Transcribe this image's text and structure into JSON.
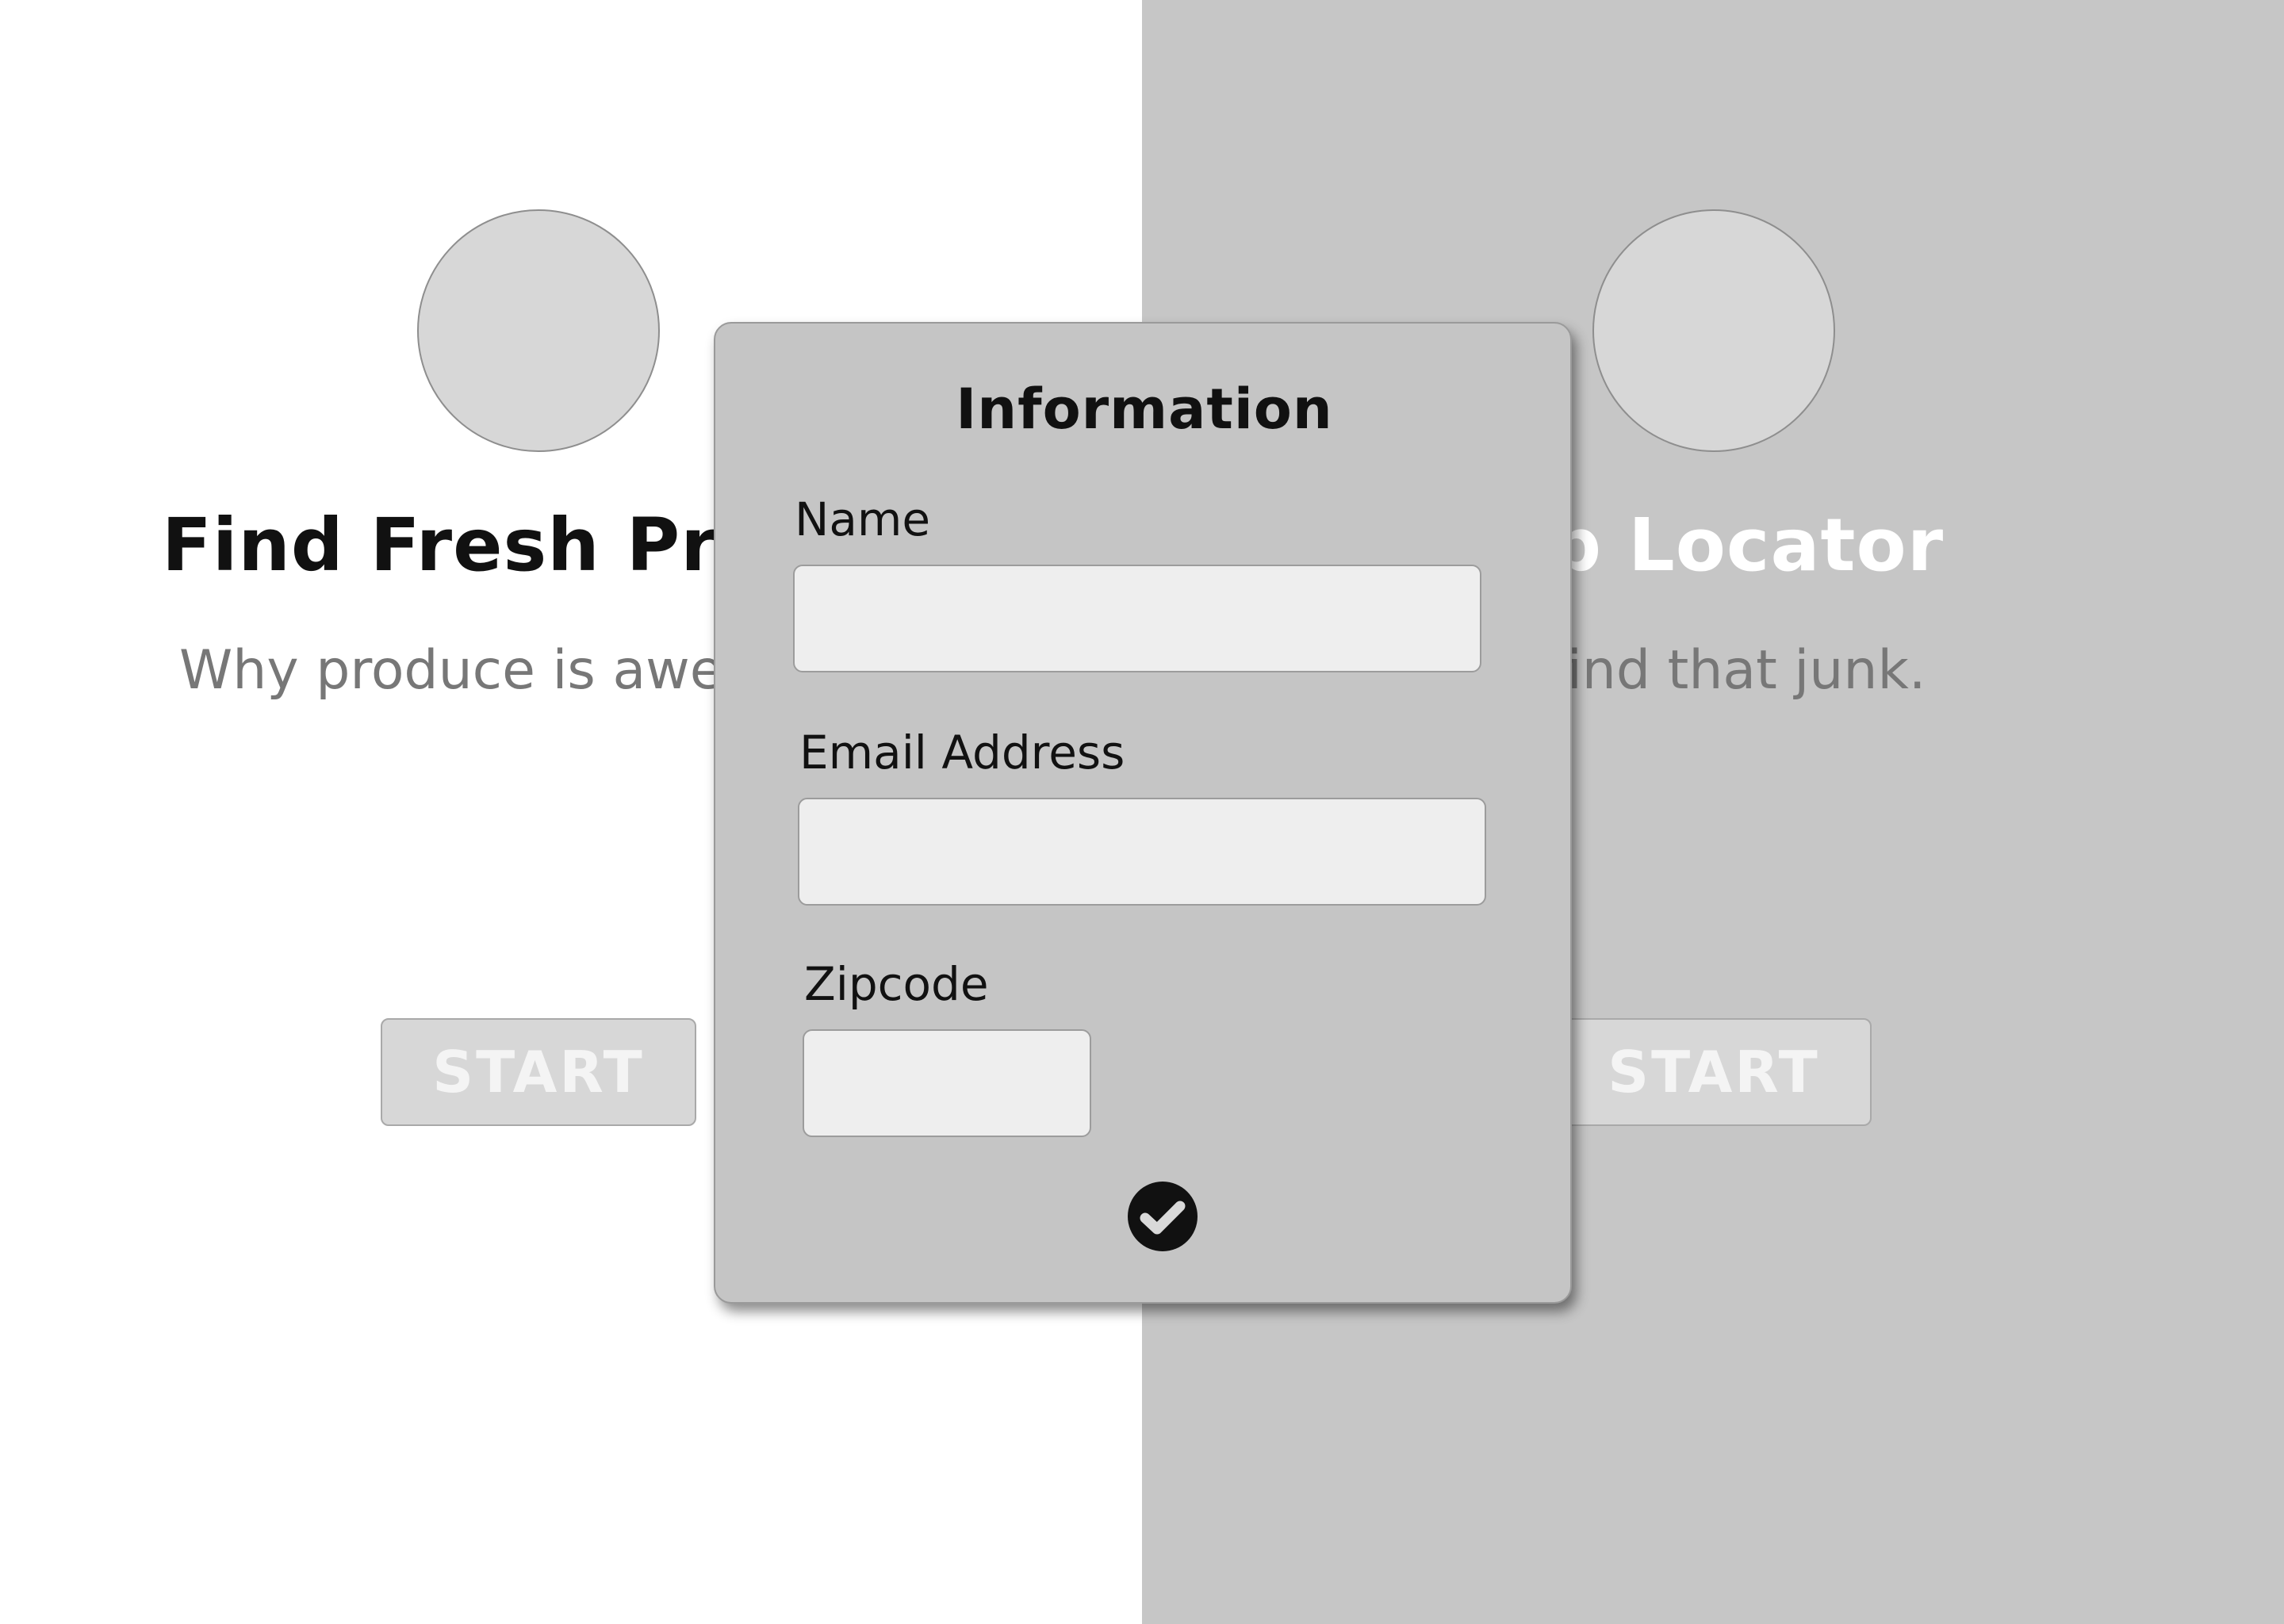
{
  "left_card": {
    "title": "Find Fresh Produce",
    "subtitle": "Why produce is awesome.",
    "button_label": "START"
  },
  "right_card": {
    "title": "Swamp Locator",
    "subtitle": "Where to find that junk.",
    "button_label": "START"
  },
  "modal": {
    "title": "Information",
    "fields": [
      {
        "label": "Name",
        "value": "",
        "placeholder": ""
      },
      {
        "label": "Email Address",
        "value": "",
        "placeholder": ""
      },
      {
        "label": "Zipcode",
        "value": "",
        "placeholder": ""
      }
    ],
    "confirm_icon": "check-circle-icon"
  },
  "colors": {
    "right_panel": "#c6c6c6",
    "modal_bg": "#c5c5c5",
    "input_bg": "#eeeeee",
    "placeholder_circle": "#d7d7d7"
  }
}
